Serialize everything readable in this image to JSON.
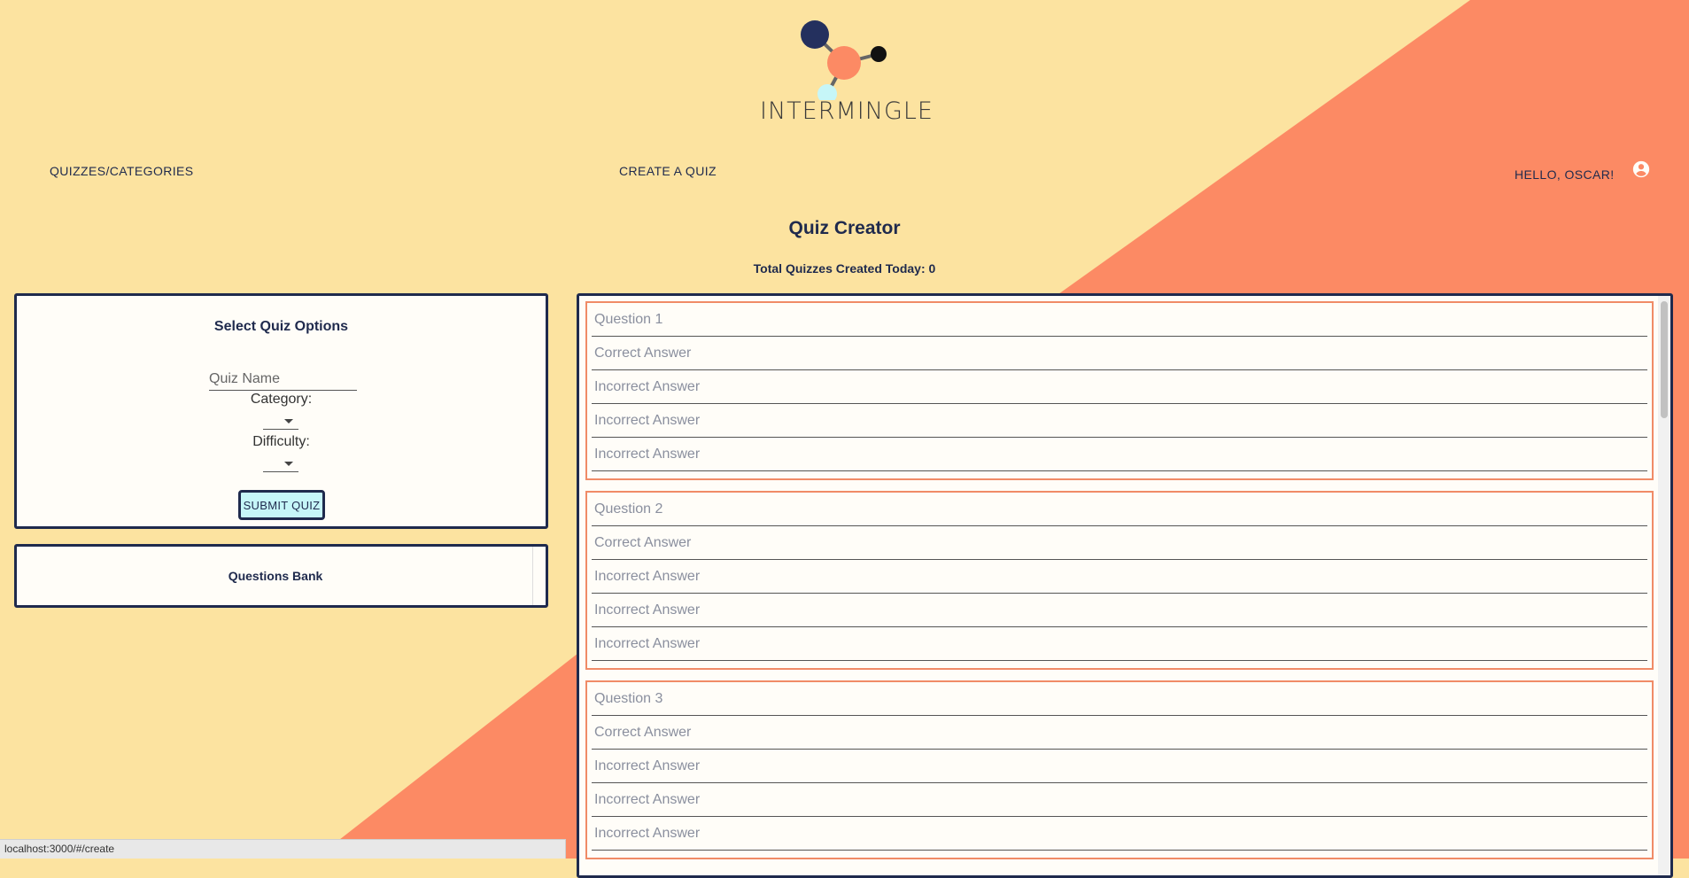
{
  "brand": {
    "name": "INTERMINGLE"
  },
  "nav": {
    "quizzes": "QUIZZES/CATEGORIES",
    "create": "CREATE A QUIZ",
    "greeting": "HELLO, OSCAR!"
  },
  "page": {
    "title": "Quiz Creator",
    "subtitle": "Total Quizzes Created Today: 0"
  },
  "options": {
    "title": "Select Quiz Options",
    "quiz_name_placeholder": "Quiz Name",
    "category_label": "Category:",
    "category_value": "",
    "difficulty_label": "Difficulty:",
    "difficulty_value": "",
    "submit_label": "SUBMIT QUIZ"
  },
  "bank": {
    "title": "Questions Bank"
  },
  "questions": [
    {
      "question": "Question 1",
      "correct": "Correct Answer",
      "incorrect": [
        "Incorrect Answer",
        "Incorrect Answer",
        "Incorrect Answer"
      ]
    },
    {
      "question": "Question 2",
      "correct": "Correct Answer",
      "incorrect": [
        "Incorrect Answer",
        "Incorrect Answer",
        "Incorrect Answer"
      ]
    },
    {
      "question": "Question 3",
      "correct": "Correct Answer",
      "incorrect": [
        "Incorrect Answer",
        "Incorrect Answer",
        "Incorrect Answer"
      ]
    }
  ],
  "status_bar": {
    "url": "localhost:3000/#/create"
  },
  "colors": {
    "background": "#fce3a0",
    "accent": "#fc8a64",
    "navy": "#1f2a4d",
    "button": "#c6f6f8",
    "panel": "#fffdf8"
  },
  "icons": {
    "account": "account-circle-icon",
    "dropdown": "caret-down-icon"
  }
}
